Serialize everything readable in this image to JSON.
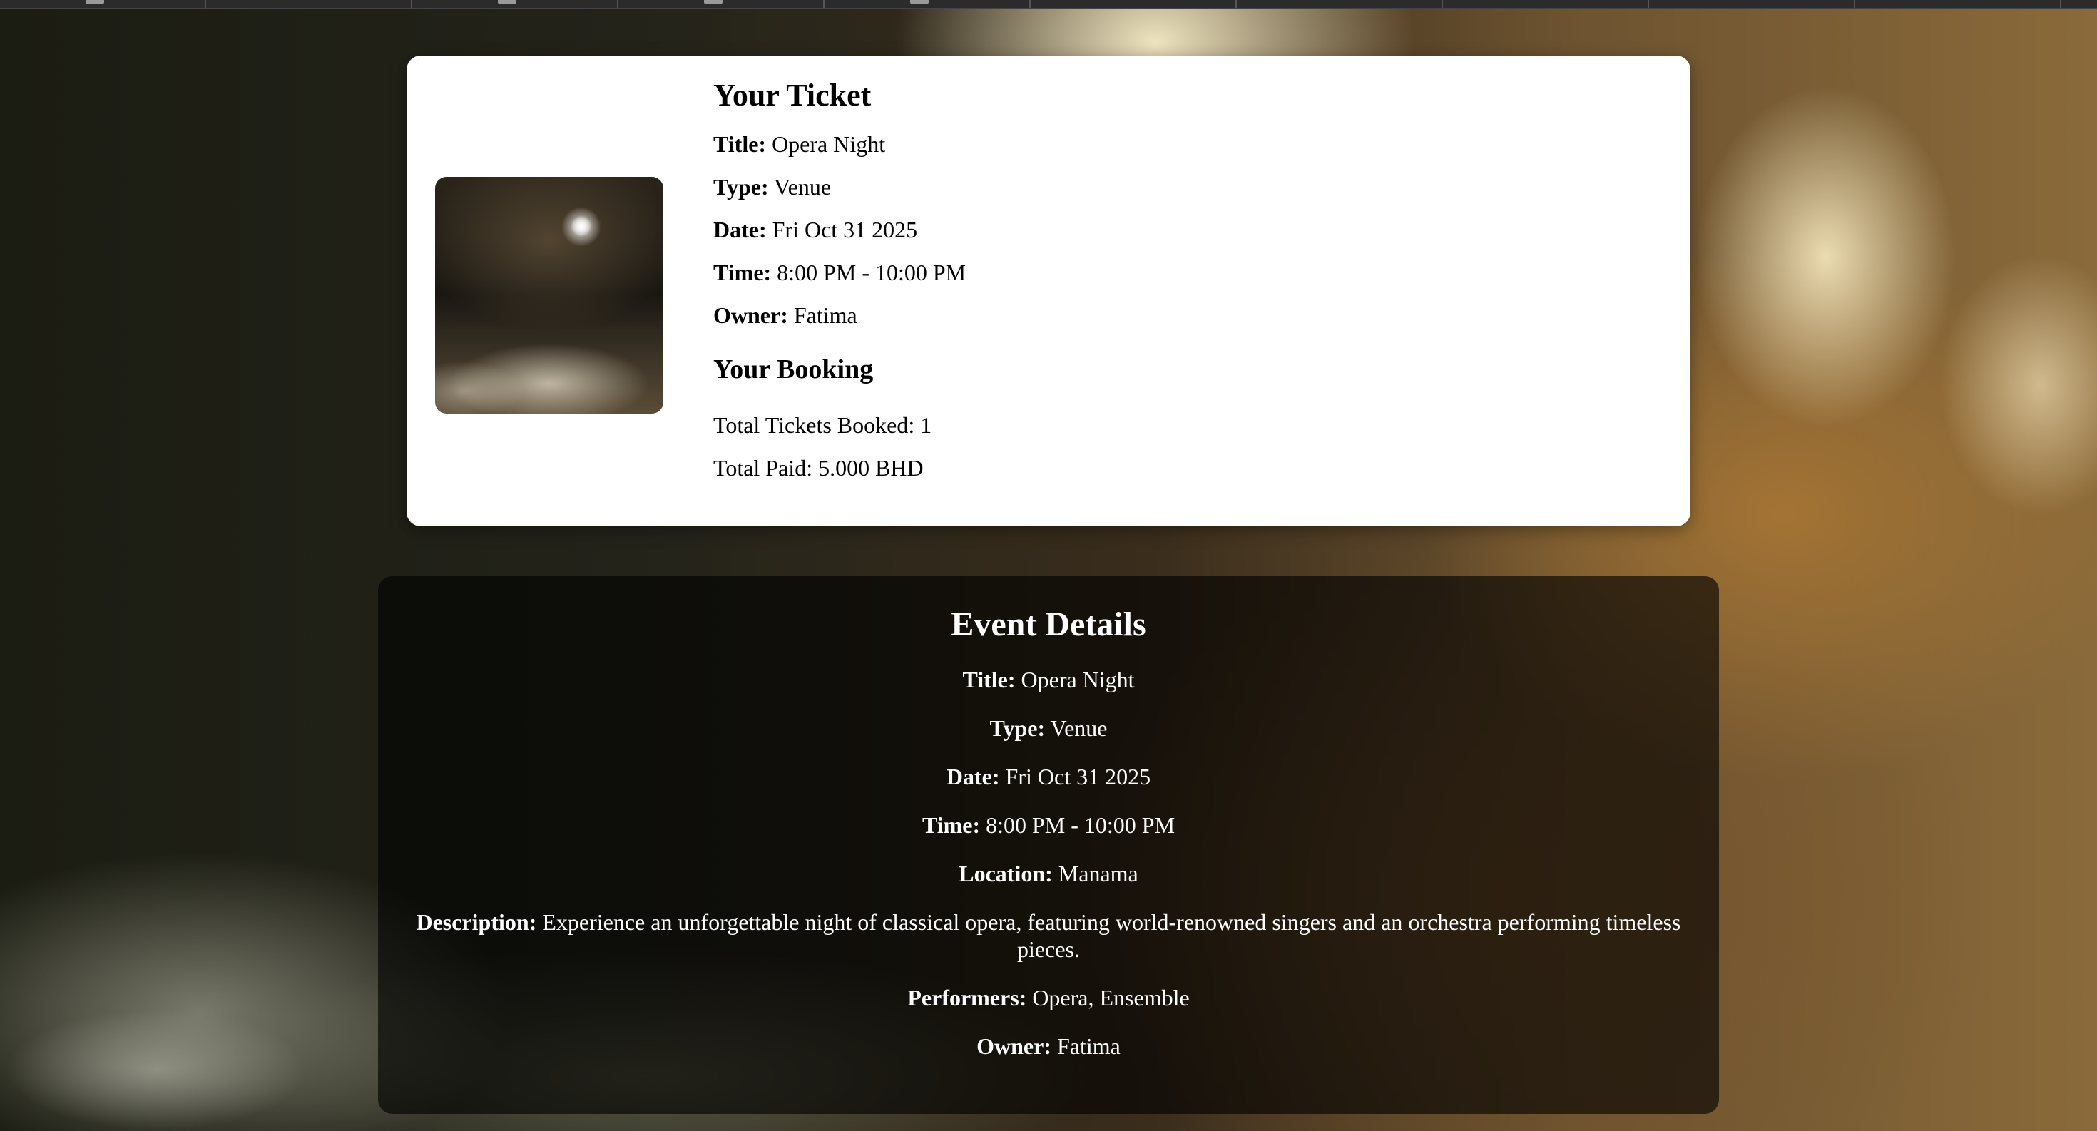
{
  "ticket": {
    "heading": "Your Ticket",
    "fields": [
      {
        "label": "Title:",
        "value": "Opera Night"
      },
      {
        "label": "Type:",
        "value": "Venue"
      },
      {
        "label": "Date:",
        "value": "Fri Oct 31 2025"
      },
      {
        "label": "Time:",
        "value": "8:00 PM - 10:00 PM"
      },
      {
        "label": "Owner:",
        "value": "Fatima"
      }
    ],
    "image": {
      "icon": "event-thumbnail-image"
    }
  },
  "booking": {
    "heading": "Your Booking",
    "total_tickets": "Total Tickets Booked: 1",
    "total_paid": "Total Paid: 5.000 BHD"
  },
  "event": {
    "heading": "Event Details",
    "fields": [
      {
        "label": "Title:",
        "value": "Opera Night"
      },
      {
        "label": "Type:",
        "value": "Venue"
      },
      {
        "label": "Date:",
        "value": "Fri Oct 31 2025"
      },
      {
        "label": "Time:",
        "value": "8:00 PM - 10:00 PM"
      },
      {
        "label": "Location:",
        "value": "Manama"
      },
      {
        "label": "Description:",
        "value": "Experience an unforgettable night of classical opera, featuring world-renowned singers and an orchestra performing timeless pieces."
      },
      {
        "label": "Performers:",
        "value": "Opera, Ensemble"
      },
      {
        "label": "Owner:",
        "value": "Fatima"
      }
    ]
  },
  "colors": {
    "card_bg": "#ffffff",
    "panel_bg": "rgba(0,0,0,0.62)",
    "panel_text": "#ffffff"
  }
}
